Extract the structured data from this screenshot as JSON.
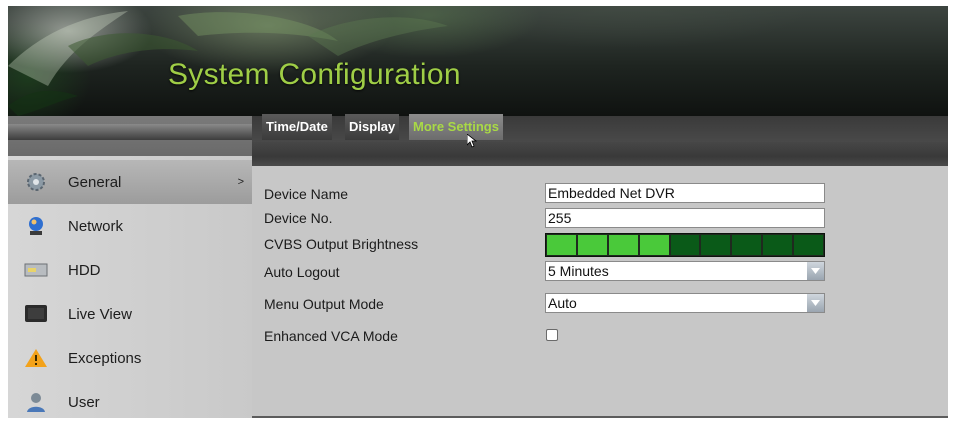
{
  "header": {
    "title": "System Configuration"
  },
  "sidebar": {
    "items": [
      {
        "label": "General",
        "icon": "gear-icon",
        "active": true,
        "chevron": ">"
      },
      {
        "label": "Network",
        "icon": "network-globe-icon"
      },
      {
        "label": "HDD",
        "icon": "hdd-icon"
      },
      {
        "label": "Live View",
        "icon": "monitor-icon"
      },
      {
        "label": "Exceptions",
        "icon": "warning-icon"
      },
      {
        "label": "User",
        "icon": "user-icon"
      }
    ]
  },
  "tabs": [
    {
      "label": "Time/Date",
      "selected": false
    },
    {
      "label": "Display",
      "selected": false
    },
    {
      "label": "More Settings",
      "selected": true
    }
  ],
  "form": {
    "device_name": {
      "label": "Device Name",
      "value": "Embedded Net DVR"
    },
    "device_no": {
      "label": "Device No.",
      "value": "255"
    },
    "cvbs_brightness": {
      "label": "CVBS Output Brightness",
      "level_segments_on": 4,
      "segments_total": 9
    },
    "auto_logout": {
      "label": "Auto Logout",
      "value": "5 Minutes"
    },
    "menu_output_mode": {
      "label": "Menu Output Mode",
      "value": "Auto"
    },
    "enhanced_vca_mode": {
      "label": "Enhanced VCA Mode",
      "checked": false
    }
  },
  "colors": {
    "title_green": "#9fce46",
    "tab_selected_text": "#a9d946",
    "slider_on": "#4ac93a",
    "slider_off": "#0a5a18"
  }
}
